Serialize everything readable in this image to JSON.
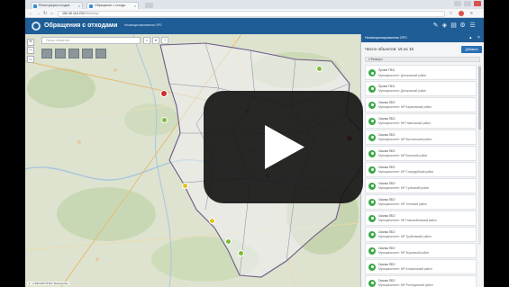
{
  "browser": {
    "tabs": [
      {
        "label": "Регистрация отходов",
        "active": false
      },
      {
        "label": "Обращение с отхода",
        "active": true
      }
    ],
    "url_host": "192.40.115.232",
    "url_path": "/WebMap/"
  },
  "app": {
    "title": "Обращения с отходами",
    "subtitle": "Несанкционированная ОРО"
  },
  "map": {
    "search_placeholder": "Поиск объектов",
    "scale_text": "1 : 1 400 000  ©ГИС Технологии",
    "marker_colors": {
      "active": "#7ebc37",
      "pending": "#e3c31b",
      "alert": "#d42b2b"
    }
  },
  "panel": {
    "title": "Несанкционированная ОРО",
    "count_text": "Число объектов: 15 из 15",
    "button_label": "Добавить",
    "filter_label": "▾ Фильтры",
    "items": [
      {
        "title": "Проект ПБО",
        "subtitle": "Муниципалитет: Дятьковский район"
      },
      {
        "title": "Проект ПБО",
        "subtitle": "Муниципалитет: Дятьковский район"
      },
      {
        "title": "Свалка ПБО",
        "subtitle": "Муниципалитет: МР Карачевский район"
      },
      {
        "title": "Свалка ПБО",
        "subtitle": "Муниципалитет: МР Навлинский район"
      },
      {
        "title": "Свалка ПБО",
        "subtitle": "Муниципалитет: МР Выгоничский район"
      },
      {
        "title": "Свалка ПБО",
        "subtitle": "Муниципалитет: МР Брянский район"
      },
      {
        "title": "Свалка ПБО",
        "subtitle": "Муниципалитет: МР Стародубский район"
      },
      {
        "title": "Свалка ПБО",
        "subtitle": "Муниципалитет: МР Суземский район"
      },
      {
        "title": "Свалка ПБО",
        "subtitle": "Муниципалитет: МР Унечский район"
      },
      {
        "title": "Свалка ПБО",
        "subtitle": "Муниципалитет: МР Новозыбковский район"
      },
      {
        "title": "Свалка ПБО",
        "subtitle": "Муниципалитет: МР Трубчевский район"
      },
      {
        "title": "Свалка ПБО",
        "subtitle": "Муниципалитет: МР Жуковский район"
      },
      {
        "title": "Свалка ПБО",
        "subtitle": "Муниципалитет: МР Комаричский район"
      },
      {
        "title": "Свалка ПБО",
        "subtitle": "Муниципалитет: МР Рогнединский район"
      }
    ]
  },
  "video": {
    "overlay": "play-button"
  }
}
